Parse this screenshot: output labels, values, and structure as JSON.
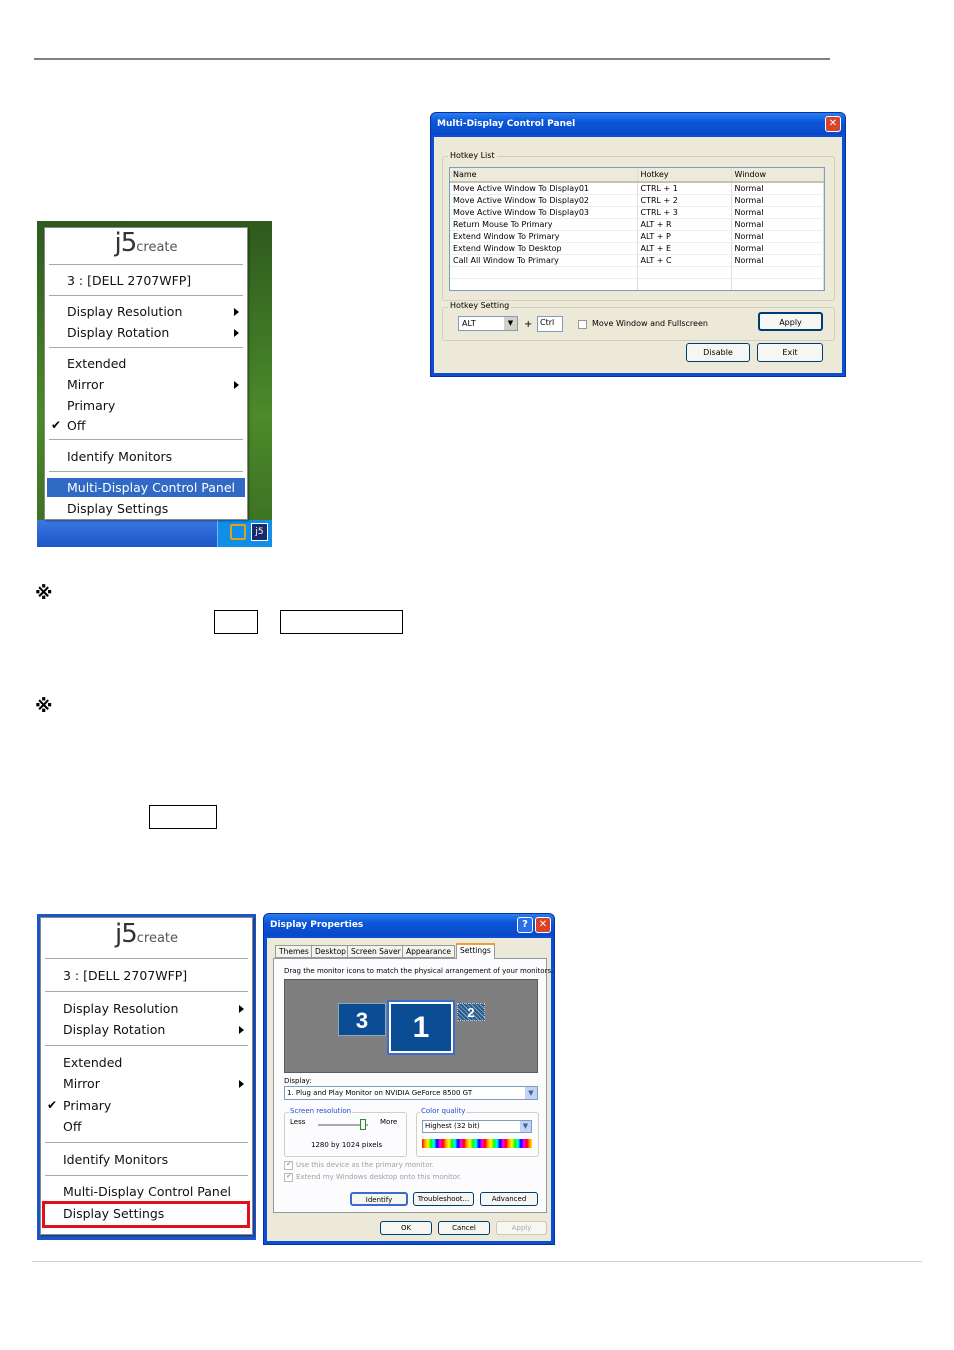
{
  "document": {
    "note_mark_1": "※",
    "note_mark_2": "※"
  },
  "tray_menu_1": {
    "logo": {
      "main": "j5",
      "sub": "create"
    },
    "device": "3 : [DELL 2707WFP]",
    "items": [
      "Display Resolution",
      "Display Rotation",
      "Extended",
      "Mirror",
      "Primary",
      "Off",
      "Identify Monitors",
      "Multi-Display Control Panel",
      "Display Settings"
    ],
    "checked": "Off",
    "highlighted": "Multi-Display Control Panel",
    "tray_icon": "j5"
  },
  "control_panel": {
    "title": "Multi-Display Control Panel",
    "hotkey_list_label": "Hotkey List",
    "columns": [
      "Name",
      "Hotkey",
      "Window"
    ],
    "rows": [
      [
        "Move Active Window To Display01",
        "CTRL + 1",
        "Normal"
      ],
      [
        "Move Active Window To Display02",
        "CTRL + 2",
        "Normal"
      ],
      [
        "Move Active Window To Display03",
        "CTRL + 3",
        "Normal"
      ],
      [
        "Return Mouse To Primary",
        "ALT + R",
        "Normal"
      ],
      [
        "Extend Window To Primary",
        "ALT + P",
        "Normal"
      ],
      [
        "Extend Window To Desktop",
        "ALT + E",
        "Normal"
      ],
      [
        "Call All Window To Primary",
        "ALT + C",
        "Normal"
      ]
    ],
    "hotkey_setting_label": "Hotkey Setting",
    "modifier_value": "ALT",
    "plus": "+",
    "key_value": "Ctrl",
    "fullscreen_label": "Move Window and Fullscreen",
    "fullscreen_checked": false,
    "apply": "Apply",
    "disable": "Disable",
    "exit": "Exit"
  },
  "tray_menu_2": {
    "logo": {
      "main": "j5",
      "sub": "create"
    },
    "device": "3 : [DELL 2707WFP]",
    "items": [
      "Display Resolution",
      "Display Rotation",
      "Extended",
      "Mirror",
      "Primary",
      "Off",
      "Identify Monitors",
      "Multi-Display Control Panel",
      "Display Settings"
    ],
    "checked": "Primary",
    "outlined": "Display Settings",
    "outline_color": "#e0101a"
  },
  "display_properties": {
    "title": "Display Properties",
    "tabs": [
      "Themes",
      "Desktop",
      "Screen Saver",
      "Appearance",
      "Settings"
    ],
    "active_tab": "Settings",
    "instruction": "Drag the monitor icons to match the physical arrangement of your monitors.",
    "monitors": [
      "3",
      "1",
      "2"
    ],
    "display_label": "Display:",
    "display_value": "1. Plug and Play Monitor on NVIDIA GeForce 8500 GT",
    "resolution_label": "Screen resolution",
    "less": "Less",
    "more": "More",
    "resolution_value": "1280 by 1024 pixels",
    "color_label": "Color quality",
    "color_value": "Highest (32 bit)",
    "primary_check": "Use this device as the primary monitor.",
    "extend_check": "Extend my Windows desktop onto this monitor.",
    "identify": "Identify",
    "troubleshoot": "Troubleshoot...",
    "advanced": "Advanced",
    "ok": "OK",
    "cancel": "Cancel",
    "apply": "Apply"
  }
}
